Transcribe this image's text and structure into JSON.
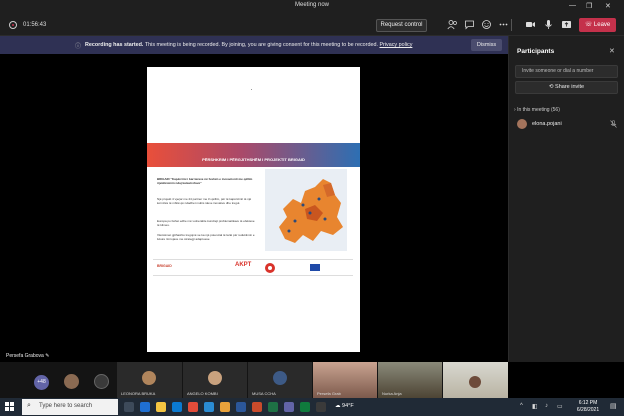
{
  "window": {
    "title": "Meeting now",
    "minimize": "—",
    "restore": "❐",
    "close": "✕"
  },
  "toolbar": {
    "timer": "01:56:43",
    "request_control": "Request control",
    "leave": "Leave",
    "icons": [
      "participants-icon",
      "chat-icon",
      "reactions-icon",
      "more-icon",
      "camera-icon",
      "mic-icon",
      "share-icon"
    ]
  },
  "banner": {
    "bold": "Recording has started.",
    "text": "This meeting is being recorded. By joining, you are giving consent for this meeting to be recorded.",
    "link": "Privacy policy",
    "dismiss": "Dismiss"
  },
  "slide": {
    "title": "PËRSHKRIM I PËRGJITHSHËM I PROJEKTIT BRIGAID",
    "para1": "BRIGAID \"Kapërcimi i barrierave në fushën e inovacionit me qëllim rijetëtësimin ndaj katastrofave\"",
    "para2": "Një projekt 4 vjeçar me 24 partner me ⅔ qëllim, për të kapërcimit të një kornizës të mbitë që ndadhet mubis ideve inovative dhe tregut.",
    "para3": "Europa po bëhet edhe më vulnerable kundrejt problematikave të efekteve të klimes.",
    "para4": "Vlerësimet gjithashtu tregojnë se ka një potencial të lartë për reduktimin e lukure rimrojave me strategji adaptuese",
    "logo_left": "BRIGAID",
    "logo_mid": "AKPT"
  },
  "presenter": {
    "name": "Persefa Grabova"
  },
  "participants_panel": {
    "title": "Participants",
    "invite_placeholder": "Invite someone or dial a number",
    "share_invite": "Share invite",
    "section": "In this meeting (56)",
    "people": [
      {
        "name": "elona.pojani"
      }
    ]
  },
  "strip": {
    "more_count": "+48",
    "tiles": [
      {
        "name": "LEONORA BRUKA"
      },
      {
        "name": "ANGELO KOMBI"
      },
      {
        "name": "MUSA CCHA"
      },
      {
        "name": "Persefa Grab"
      },
      {
        "name": "Nurka Anja"
      }
    ]
  },
  "taskbar": {
    "search_placeholder": "Type here to search",
    "weather": "94°F",
    "time": "6:12 PM",
    "date": "6/28/2021"
  },
  "colors": {
    "leave": "#c4314b",
    "banner": "#2f3154",
    "accent": "#6264a7",
    "taskbar": "#202a36"
  }
}
